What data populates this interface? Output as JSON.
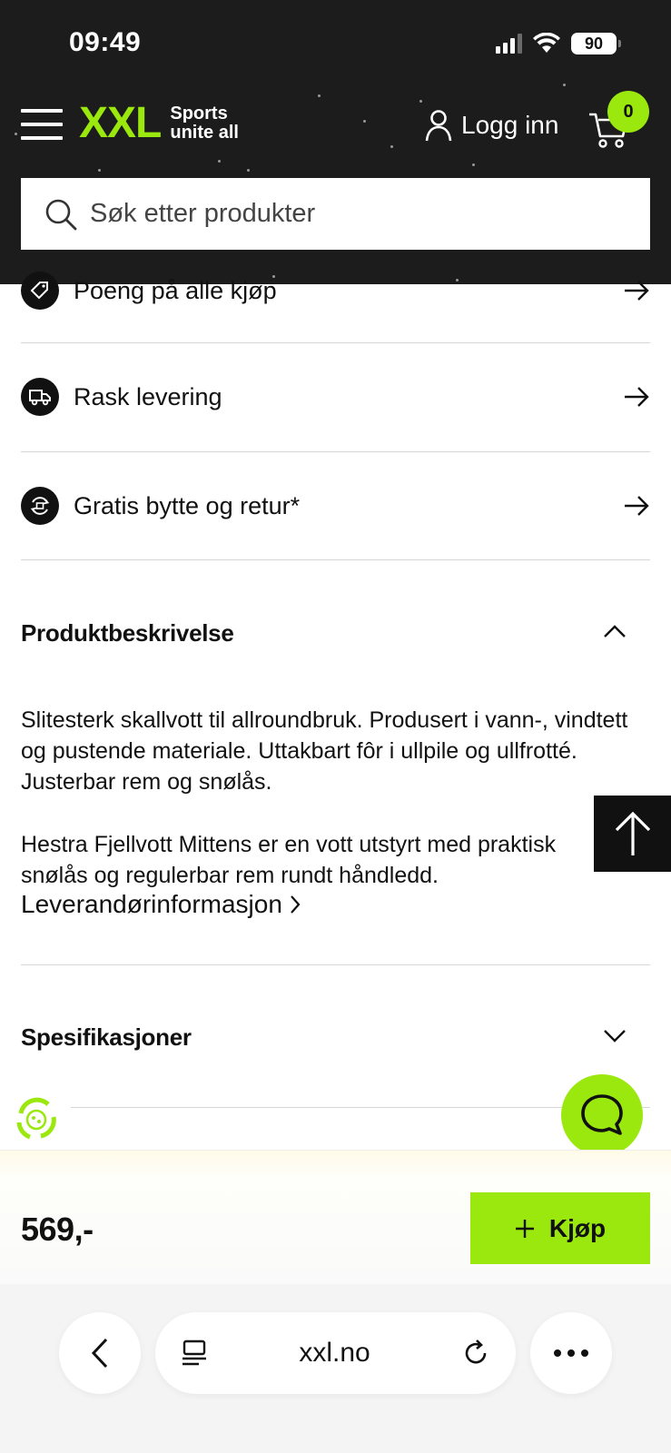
{
  "status_bar": {
    "time": "09:49",
    "battery": "90"
  },
  "header": {
    "logo_text": "XXL",
    "logo_tagline_1": "Sports",
    "logo_tagline_2": "unite all",
    "login_label": "Logg inn",
    "cart_count": "0",
    "accent_color": "#9be80f"
  },
  "search": {
    "placeholder": "Søk etter produkter"
  },
  "benefits": [
    {
      "label": "Poeng på alle kjøp",
      "icon": "tag-icon"
    },
    {
      "label": "Rask levering",
      "icon": "truck-icon"
    },
    {
      "label": "Gratis bytte og retur*",
      "icon": "return-icon"
    }
  ],
  "description": {
    "title": "Produktbeskrivelse",
    "paragraph_1": "Slitesterk skallvott til allroundbruk. Produsert i vann-, vindtett og pustende materiale. Uttakbart fôr i ullpile og ullfrotté. Justerbar rem og snølås.",
    "paragraph_2": "Hestra Fjellvott Mittens er en vott utstyrt med praktisk snølås og regulerbar rem rundt håndledd.",
    "supplier_link": "Leverandørinformasjon"
  },
  "specifications": {
    "title": "Spesifikasjoner"
  },
  "buy_bar": {
    "price": "569,-",
    "buy_label": "Kjøp"
  },
  "browser": {
    "url": "xxl.no"
  }
}
